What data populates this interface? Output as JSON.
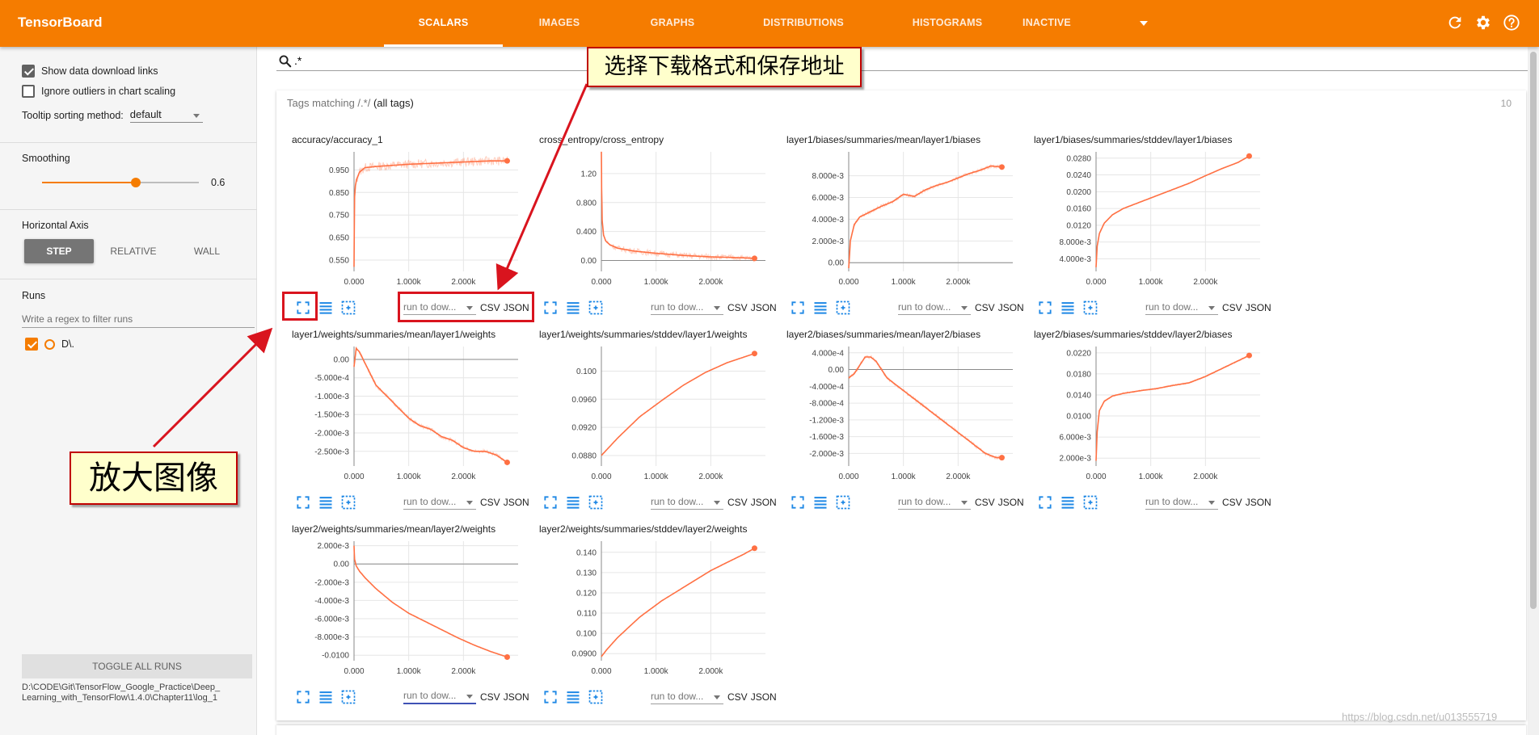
{
  "header": {
    "title": "TensorBoard",
    "tabs": [
      {
        "label": "SCALARS",
        "active": true
      },
      {
        "label": "IMAGES",
        "active": false
      },
      {
        "label": "GRAPHS",
        "active": false
      },
      {
        "label": "DISTRIBUTIONS",
        "active": false
      },
      {
        "label": "HISTOGRAMS",
        "active": false
      },
      {
        "label": "INACTIVE",
        "active": false
      }
    ],
    "icons": [
      "refresh-icon",
      "settings-icon",
      "help-icon"
    ],
    "color": "#f57c00"
  },
  "sidebar": {
    "show_download_links": {
      "label": "Show data download links",
      "checked": true
    },
    "ignore_outliers": {
      "label": "Ignore outliers in chart scaling",
      "checked": false
    },
    "tooltip_sorting": {
      "label": "Tooltip sorting method:",
      "value": "default"
    },
    "smoothing": {
      "label": "Smoothing",
      "value": "0.6",
      "fraction": 0.6
    },
    "horizontal_axis": {
      "label": "Horizontal Axis",
      "options": [
        "STEP",
        "RELATIVE",
        "WALL"
      ],
      "selected": "STEP"
    },
    "runs": {
      "label": "Runs",
      "filter_placeholder": "Write a regex to filter runs",
      "items": [
        {
          "name": "D\\.",
          "checked": true,
          "color": "#f57c00"
        }
      ]
    },
    "toggle_all": "TOGGLE ALL RUNS",
    "log_dir": "D:\\CODE\\Git\\TensorFlow_Google_Practice\\Deep_Learning_with_TensorFlow\\1.4.0\\Chapter11\\log_1"
  },
  "main": {
    "search_value": ".*",
    "tags_header": {
      "prefix": "Tags matching /",
      "pattern": ".*",
      "suffix": "/ ",
      "all": "(all tags)"
    },
    "tag_count": "10",
    "run_select_placeholder": "run to dow...",
    "csv_label": "CSV",
    "json_label": "JSON"
  },
  "chart_data": [
    {
      "type": "line",
      "title": "accuracy/accuracy_1",
      "xlim": [
        0,
        3000
      ],
      "ylim": [
        0.5,
        1.03
      ],
      "yticks": [
        "0.950",
        "0.850",
        "0.750",
        "0.650",
        "0.550"
      ],
      "ytick_values": [
        0.95,
        0.85,
        0.75,
        0.65,
        0.55
      ],
      "xticks": [
        "0.000",
        "1.000k",
        "2.000k"
      ],
      "xtick_values": [
        0,
        1000,
        2000
      ],
      "x": [
        0,
        10,
        25,
        50,
        100,
        200,
        400,
        700,
        1000,
        1500,
        2000,
        2500,
        2800
      ],
      "y": [
        0.52,
        0.83,
        0.88,
        0.91,
        0.94,
        0.96,
        0.965,
        0.97,
        0.975,
        0.98,
        0.985,
        0.99,
        0.99
      ],
      "noise": 0.02,
      "yzero": false
    },
    {
      "type": "line",
      "title": "cross_entropy/cross_entropy",
      "xlim": [
        0,
        3000
      ],
      "ylim": [
        -0.15,
        1.5
      ],
      "yticks": [
        "1.20",
        "0.800",
        "0.400",
        "0.00"
      ],
      "ytick_values": [
        1.2,
        0.8,
        0.4,
        0.0
      ],
      "xticks": [
        "0.000",
        "1.000k",
        "2.000k"
      ],
      "xtick_values": [
        0,
        1000,
        2000
      ],
      "x": [
        0,
        5,
        15,
        40,
        80,
        150,
        300,
        600,
        1000,
        1500,
        2000,
        2500,
        2800
      ],
      "y": [
        1.5,
        1.0,
        0.55,
        0.35,
        0.27,
        0.22,
        0.17,
        0.13,
        0.1,
        0.07,
        0.05,
        0.04,
        0.03
      ],
      "noise": 0.04,
      "yzero": true
    },
    {
      "type": "line",
      "title": "layer1/biases/summaries/mean/layer1/biases",
      "xlim": [
        0,
        3000
      ],
      "ylim": [
        -0.0008,
        0.0102
      ],
      "yticks": [
        "8.000e-3",
        "6.000e-3",
        "4.000e-3",
        "2.000e-3",
        "0.00"
      ],
      "ytick_values": [
        0.008,
        0.006,
        0.004,
        0.002,
        0.0
      ],
      "xticks": [
        "0.000",
        "1.000k",
        "2.000k"
      ],
      "xtick_values": [
        0,
        1000,
        2000
      ],
      "x": [
        0,
        30,
        100,
        200,
        400,
        600,
        800,
        1000,
        1200,
        1400,
        1600,
        1800,
        2000,
        2200,
        2400,
        2600,
        2800
      ],
      "y": [
        -0.0005,
        0.002,
        0.0035,
        0.0042,
        0.0047,
        0.0052,
        0.0056,
        0.0063,
        0.0061,
        0.0067,
        0.0071,
        0.0074,
        0.0078,
        0.0082,
        0.0085,
        0.0089,
        0.0088
      ],
      "noise": 0.00015,
      "yzero": true
    },
    {
      "type": "line",
      "title": "layer1/biases/summaries/stddev/layer1/biases",
      "xlim": [
        0,
        3000
      ],
      "ylim": [
        0.001,
        0.0295
      ],
      "yticks": [
        "0.0280",
        "0.0240",
        "0.0200",
        "0.0160",
        "0.0120",
        "8.000e-3",
        "4.000e-3"
      ],
      "ytick_values": [
        0.028,
        0.024,
        0.02,
        0.016,
        0.012,
        0.008,
        0.004
      ],
      "xticks": [
        "0.000",
        "1.000k",
        "2.000k"
      ],
      "xtick_values": [
        0,
        1000,
        2000
      ],
      "x": [
        0,
        20,
        60,
        150,
        300,
        500,
        800,
        1100,
        1400,
        1700,
        2000,
        2300,
        2600,
        2800
      ],
      "y": [
        0.002,
        0.007,
        0.01,
        0.0125,
        0.0145,
        0.016,
        0.0175,
        0.019,
        0.0205,
        0.022,
        0.0238,
        0.0255,
        0.027,
        0.0285
      ],
      "noise": 0.0001,
      "yzero": false
    },
    {
      "type": "line",
      "title": "layer1/weights/summaries/mean/layer1/weights",
      "xlim": [
        0,
        3000
      ],
      "ylim": [
        -0.0029,
        0.00035
      ],
      "yticks": [
        "0.00",
        "-5.000e-4",
        "-1.000e-3",
        "-1.500e-3",
        "-2.000e-3",
        "-2.500e-3"
      ],
      "ytick_values": [
        0.0,
        -0.0005,
        -0.001,
        -0.0015,
        -0.002,
        -0.0025
      ],
      "xticks": [
        "0.000",
        "1.000k",
        "2.000k"
      ],
      "xtick_values": [
        0,
        1000,
        2000
      ],
      "x": [
        0,
        40,
        100,
        200,
        300,
        400,
        600,
        800,
        1000,
        1200,
        1400,
        1600,
        1800,
        2000,
        2200,
        2400,
        2600,
        2800
      ],
      "y": [
        -0.0002,
        0.0003,
        0.0002,
        -0.0001,
        -0.0004,
        -0.0007,
        -0.001,
        -0.0013,
        -0.0016,
        -0.0018,
        -0.0019,
        -0.0021,
        -0.0022,
        -0.0024,
        -0.0025,
        -0.0025,
        -0.0026,
        -0.0028
      ],
      "noise": 5e-05,
      "yzero": true
    },
    {
      "type": "line",
      "title": "layer1/weights/summaries/stddev/layer1/weights",
      "xlim": [
        0,
        3000
      ],
      "ylim": [
        0.0865,
        0.1035
      ],
      "yticks": [
        "0.100",
        "0.0960",
        "0.0920",
        "0.0880"
      ],
      "ytick_values": [
        0.1,
        0.096,
        0.092,
        0.088
      ],
      "xticks": [
        "0.000",
        "1.000k",
        "2.000k"
      ],
      "xtick_values": [
        0,
        1000,
        2000
      ],
      "x": [
        0,
        300,
        700,
        1100,
        1500,
        1900,
        2300,
        2800
      ],
      "y": [
        0.088,
        0.0905,
        0.0935,
        0.0958,
        0.098,
        0.0998,
        0.1012,
        0.1025
      ],
      "noise": 0,
      "yzero": false
    },
    {
      "type": "line",
      "title": "layer2/biases/summaries/mean/layer2/biases",
      "xlim": [
        0,
        3000
      ],
      "ylim": [
        -0.0023,
        0.00055
      ],
      "yticks": [
        "4.000e-4",
        "0.00",
        "-4.000e-4",
        "-8.000e-4",
        "-1.200e-3",
        "-1.600e-3",
        "-2.000e-3"
      ],
      "ytick_values": [
        0.0004,
        0.0,
        -0.0004,
        -0.0008,
        -0.0012,
        -0.0016,
        -0.002
      ],
      "xticks": [
        "0.000",
        "1.000k",
        "2.000k"
      ],
      "xtick_values": [
        0,
        1000,
        2000
      ],
      "x": [
        0,
        100,
        200,
        300,
        400,
        500,
        700,
        900,
        1100,
        1300,
        1500,
        1700,
        1900,
        2100,
        2300,
        2500,
        2700,
        2800
      ],
      "y": [
        -0.0002,
        -0.0001,
        0.0001,
        0.0003,
        0.0003,
        0.0002,
        -0.0002,
        -0.0004,
        -0.0006,
        -0.0008,
        -0.001,
        -0.0012,
        -0.0014,
        -0.0016,
        -0.0018,
        -0.002,
        -0.0021,
        -0.0021
      ],
      "noise": 4e-05,
      "yzero": true
    },
    {
      "type": "line",
      "title": "layer2/biases/summaries/stddev/layer2/biases",
      "xlim": [
        0,
        3000
      ],
      "ylim": [
        0.0005,
        0.0232
      ],
      "yticks": [
        "0.0220",
        "0.0180",
        "0.0140",
        "0.0100",
        "6.000e-3",
        "2.000e-3"
      ],
      "ytick_values": [
        0.022,
        0.018,
        0.014,
        0.01,
        0.006,
        0.002
      ],
      "xticks": [
        "0.000",
        "1.000k",
        "2.000k"
      ],
      "xtick_values": [
        0,
        1000,
        2000
      ],
      "x": [
        0,
        20,
        60,
        150,
        300,
        500,
        800,
        1100,
        1400,
        1700,
        2000,
        2300,
        2600,
        2800
      ],
      "y": [
        0.0015,
        0.007,
        0.011,
        0.0128,
        0.0138,
        0.0143,
        0.0148,
        0.0152,
        0.0158,
        0.0163,
        0.0175,
        0.019,
        0.0205,
        0.0215
      ],
      "noise": 0.00015,
      "yzero": false
    },
    {
      "type": "line",
      "title": "layer2/weights/summaries/mean/layer2/weights",
      "xlim": [
        0,
        3000
      ],
      "ylim": [
        -0.0106,
        0.0025
      ],
      "yticks": [
        "2.000e-3",
        "0.00",
        "-2.000e-3",
        "-4.000e-3",
        "-6.000e-3",
        "-8.000e-3",
        "-0.0100"
      ],
      "ytick_values": [
        0.002,
        0.0,
        -0.002,
        -0.004,
        -0.006,
        -0.008,
        -0.01
      ],
      "xticks": [
        "0.000",
        "1.000k",
        "2.000k"
      ],
      "xtick_values": [
        0,
        1000,
        2000
      ],
      "x": [
        0,
        10,
        40,
        100,
        200,
        400,
        700,
        1000,
        1300,
        1600,
        1900,
        2200,
        2500,
        2800
      ],
      "y": [
        0.002,
        0.0005,
        -0.0002,
        -0.0008,
        -0.0015,
        -0.0027,
        -0.0042,
        -0.0054,
        -0.0063,
        -0.0072,
        -0.0081,
        -0.0089,
        -0.0096,
        -0.0102
      ],
      "noise": 0,
      "yzero": true
    },
    {
      "type": "line",
      "title": "layer2/weights/summaries/stddev/layer2/weights",
      "xlim": [
        0,
        3000
      ],
      "ylim": [
        0.0865,
        0.1455
      ],
      "yticks": [
        "0.140",
        "0.130",
        "0.120",
        "0.110",
        "0.100",
        "0.0900"
      ],
      "ytick_values": [
        0.14,
        0.13,
        0.12,
        0.11,
        0.1,
        0.09
      ],
      "xticks": [
        "0.000",
        "1.000k",
        "2.000k"
      ],
      "xtick_values": [
        0,
        1000,
        2000
      ],
      "x": [
        0,
        100,
        300,
        500,
        700,
        900,
        1100,
        1400,
        1700,
        2000,
        2300,
        2600,
        2800
      ],
      "y": [
        0.0885,
        0.092,
        0.098,
        0.103,
        0.108,
        0.112,
        0.116,
        0.121,
        0.126,
        0.131,
        0.135,
        0.139,
        0.142
      ],
      "noise": 0,
      "yzero": false
    }
  ],
  "annotations": {
    "download_callout": "选择下载格式和保存地址",
    "zoom_callout": "放大图像",
    "watermark": "https://blog.csdn.net/u013555719"
  },
  "colors": {
    "series": "#ff7043",
    "accent": "#f57c00",
    "callout_border": "#c00000",
    "callout_bg": "#ffffcc"
  }
}
